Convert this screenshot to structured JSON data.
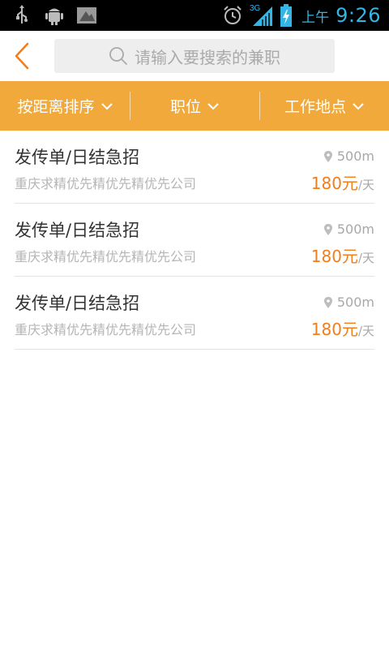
{
  "status_bar": {
    "network": "3G",
    "ampm": "上午",
    "time": "9:26"
  },
  "header": {
    "search_placeholder": "请输入要搜索的兼职"
  },
  "filters": [
    {
      "label": "按距离排序"
    },
    {
      "label": "职位"
    },
    {
      "label": "工作地点"
    }
  ],
  "jobs": [
    {
      "title": "发传单/日结急招",
      "company": "重庆求精优先精优先精优先公司",
      "distance": "500m",
      "pay": "180元",
      "pay_unit": "/天"
    },
    {
      "title": "发传单/日结急招",
      "company": "重庆求精优先精优先精优先公司",
      "distance": "500m",
      "pay": "180元",
      "pay_unit": "/天"
    },
    {
      "title": "发传单/日结急招",
      "company": "重庆求精优先精优先精优先公司",
      "distance": "500m",
      "pay": "180元",
      "pay_unit": "/天"
    }
  ],
  "colors": {
    "accent": "#f0a93a",
    "price": "#f07e1b",
    "status_text": "#33b5e5"
  }
}
